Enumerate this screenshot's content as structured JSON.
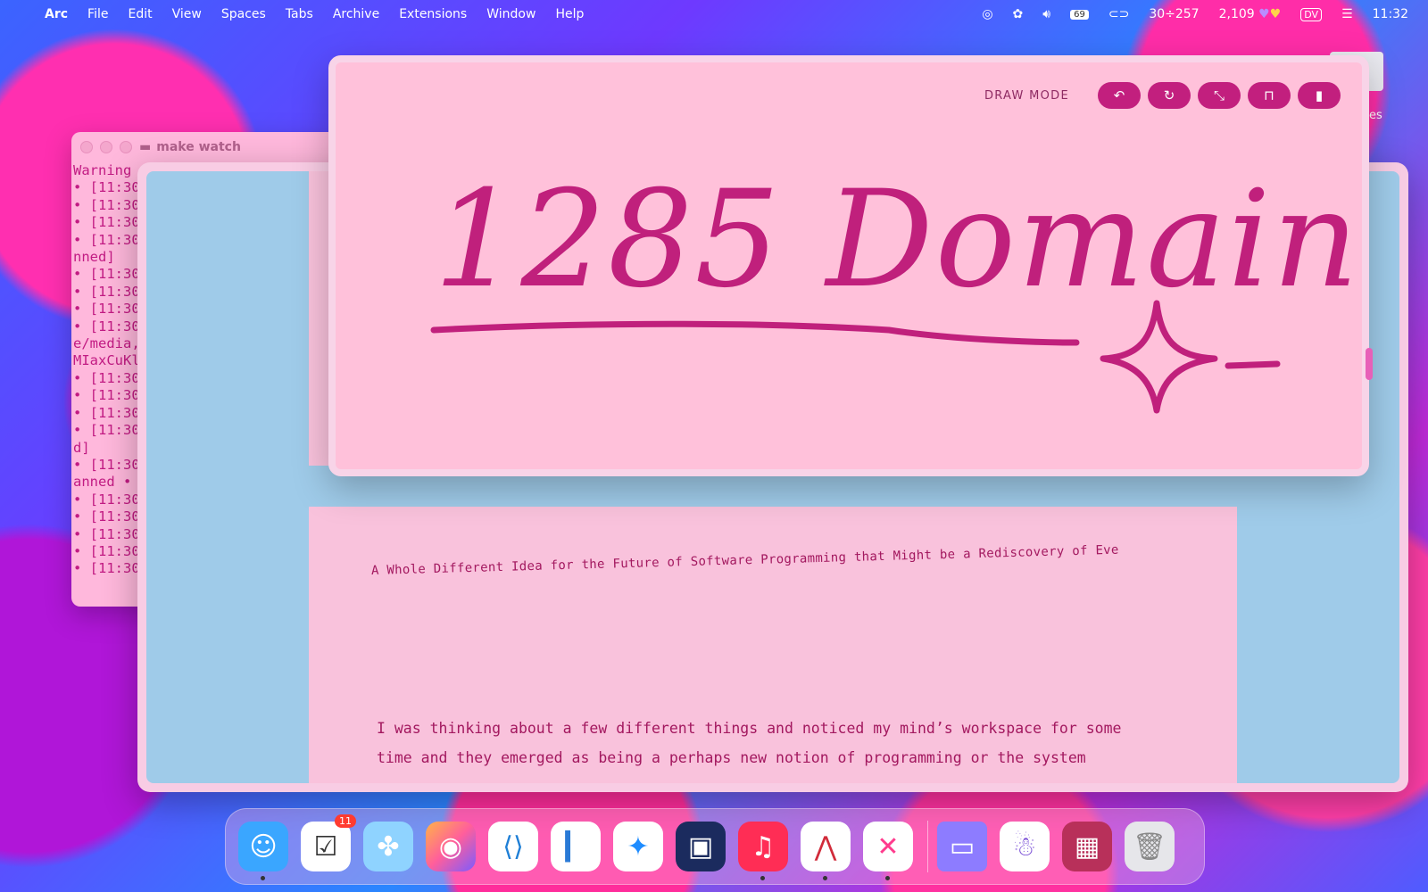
{
  "menubar": {
    "app_name": "Arc",
    "menus": [
      "File",
      "Edit",
      "View",
      "Spaces",
      "Tabs",
      "Archive",
      "Extensions",
      "Window",
      "Help"
    ],
    "battery": "69",
    "status_counter": "30÷257",
    "score": "2,109",
    "user_badge": "DV",
    "clock": "11:32"
  },
  "terminal": {
    "title": "make watch",
    "lines": [
      "Warning",
      "• [11:30",
      "• [11:30",
      "• [11:30",
      "• [11:30",
      "nned]",
      "• [11:30",
      "• [11:30",
      "• [11:30",
      "• [11:30",
      "e/media,",
      "MIaxCuKl",
      "• [11:30",
      "• [11:30",
      "• [11:30",
      "• [11:30",
      "d]",
      "• [11:30",
      "anned •",
      "• [11:30",
      "• [11:30",
      "• [11:30",
      "• [11:30",
      "• [11:30"
    ]
  },
  "draw": {
    "mode_label": "DRAW MODE",
    "handwriting": "1285 Domain"
  },
  "article": {
    "title": "A Whole Different Idea for the Future of Software Programming that Might be a Rediscovery of Eve",
    "paragraph": "I was thinking about a few different things and noticed my mind’s workspace for some time and they emerged as being a perhaps new notion of programming or the system"
  },
  "dock": {
    "reminders_badge": "11"
  },
  "desktop": {
    "partial_label": "es"
  },
  "colors": {
    "accent": "#c21f7e",
    "window_pink": "#ffc1da",
    "window_blue": "#9fcbe9"
  }
}
